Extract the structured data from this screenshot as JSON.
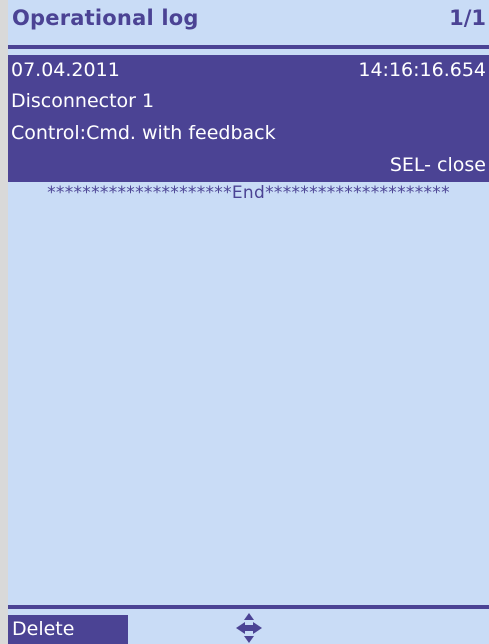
{
  "header": {
    "title": "Operational log",
    "page_indicator": "1/1"
  },
  "log_entries": [
    {
      "date": "07.04.2011",
      "time": "14:16:16.654",
      "device": "Disconnector 1",
      "description": "Control:Cmd. with feedback",
      "action": "SEL- close"
    }
  ],
  "end_marker": "*********************End*********************",
  "footer": {
    "softkey_label": "Delete",
    "nav_icon": "navigate-arrows-icon"
  },
  "colors": {
    "background": "#c9dcf6",
    "accent": "#4b4394",
    "highlight_text": "#ffffff"
  }
}
